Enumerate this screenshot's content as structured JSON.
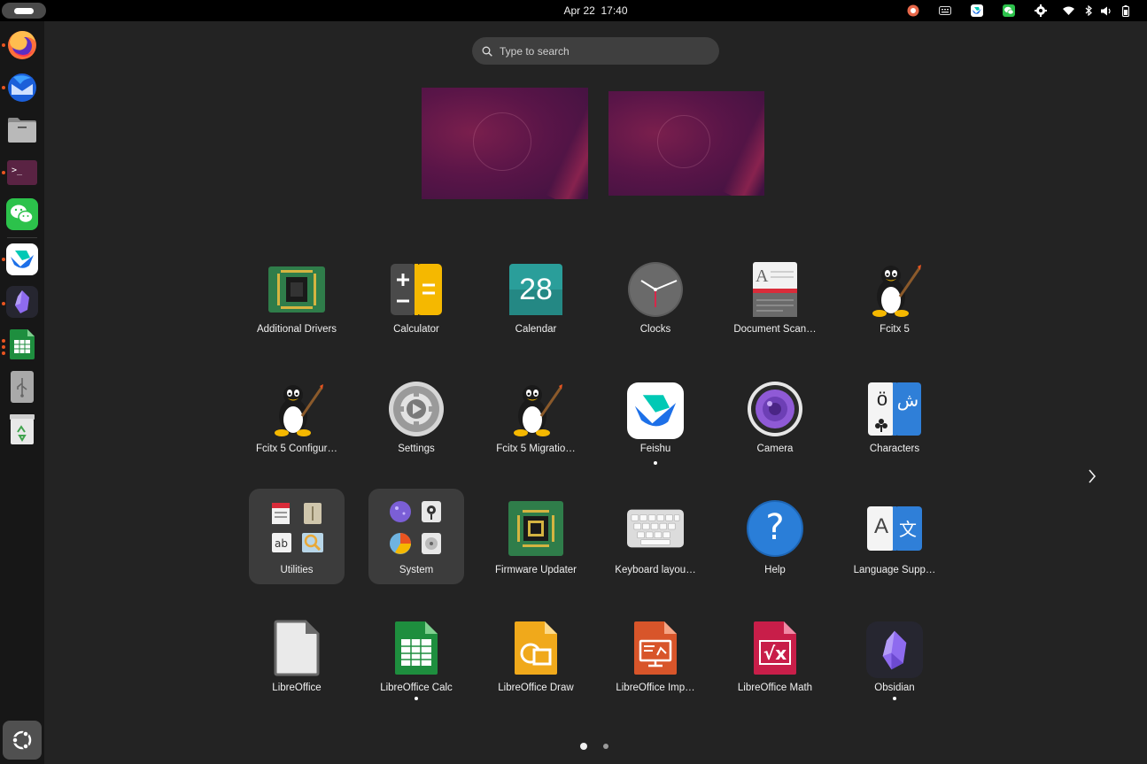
{
  "topbar": {
    "date": "Apr 22",
    "time": "17:40",
    "tray_icons": [
      "record-indicator-icon",
      "keyboard-icon",
      "feishu-tray-icon",
      "wechat-tray-icon",
      "settings-tray-icon",
      "wifi-icon",
      "bluetooth-icon",
      "volume-icon",
      "battery-icon"
    ]
  },
  "dock": {
    "items": [
      {
        "name": "firefox",
        "running": true
      },
      {
        "name": "thunderbird",
        "running": true
      },
      {
        "name": "files",
        "running": false
      },
      {
        "name": "terminal",
        "running": true
      },
      {
        "name": "wechat",
        "running": false
      },
      {
        "name": "feishu",
        "running": true
      },
      {
        "name": "obsidian",
        "running": true
      },
      {
        "name": "libreoffice-calc",
        "running": true
      },
      {
        "name": "usb-drive",
        "running": false
      },
      {
        "name": "trash",
        "running": false
      }
    ],
    "show_apps": "show-applications"
  },
  "search": {
    "placeholder": "Type to search"
  },
  "apps": {
    "row1": [
      {
        "label": "Additional Drivers",
        "icon": "chip-icon"
      },
      {
        "label": "Calculator",
        "icon": "calculator-icon"
      },
      {
        "label": "Calendar",
        "icon": "calendar-icon",
        "day": "28"
      },
      {
        "label": "Clocks",
        "icon": "clock-icon"
      },
      {
        "label": "Document Scan…",
        "icon": "scanner-icon"
      },
      {
        "label": "Fcitx 5",
        "icon": "tux-icon"
      }
    ],
    "row2": [
      {
        "label": "Fcitx 5 Configur…",
        "icon": "tux-icon"
      },
      {
        "label": "Settings",
        "icon": "gear-icon"
      },
      {
        "label": "Fcitx 5 Migratio…",
        "icon": "tux-icon"
      },
      {
        "label": "Feishu",
        "icon": "feishu-icon",
        "running": true
      },
      {
        "label": "Camera",
        "icon": "camera-icon"
      },
      {
        "label": "Characters",
        "icon": "characters-icon",
        "glyph_left": "ö",
        "glyph_right": "ش"
      }
    ],
    "row3": [
      {
        "label": "Utilities",
        "icon": "folder-icon",
        "folder": true
      },
      {
        "label": "System",
        "icon": "folder-icon",
        "folder": true
      },
      {
        "label": "Firmware Updater",
        "icon": "chip-icon"
      },
      {
        "label": "Keyboard layou…",
        "icon": "keyboard-icon"
      },
      {
        "label": "Help",
        "icon": "help-icon",
        "glyph": "?"
      },
      {
        "label": "Language Supp…",
        "icon": "language-icon",
        "glyph_left": "A",
        "glyph_right": "文"
      }
    ],
    "row4": [
      {
        "label": "LibreOffice",
        "icon": "libreoffice-icon"
      },
      {
        "label": "LibreOffice Calc",
        "icon": "calc-icon",
        "running": true
      },
      {
        "label": "LibreOffice Draw",
        "icon": "draw-icon"
      },
      {
        "label": "LibreOffice Imp…",
        "icon": "impress-icon"
      },
      {
        "label": "LibreOffice Math",
        "icon": "math-icon",
        "glyph": "√x"
      },
      {
        "label": "Obsidian",
        "icon": "obsidian-icon",
        "running": true
      }
    ]
  },
  "pager": {
    "pages": 2,
    "current": 1
  },
  "colors": {
    "accent": "#e95420",
    "background": "#232323",
    "dock": "#171717",
    "topbar": "#000000"
  }
}
